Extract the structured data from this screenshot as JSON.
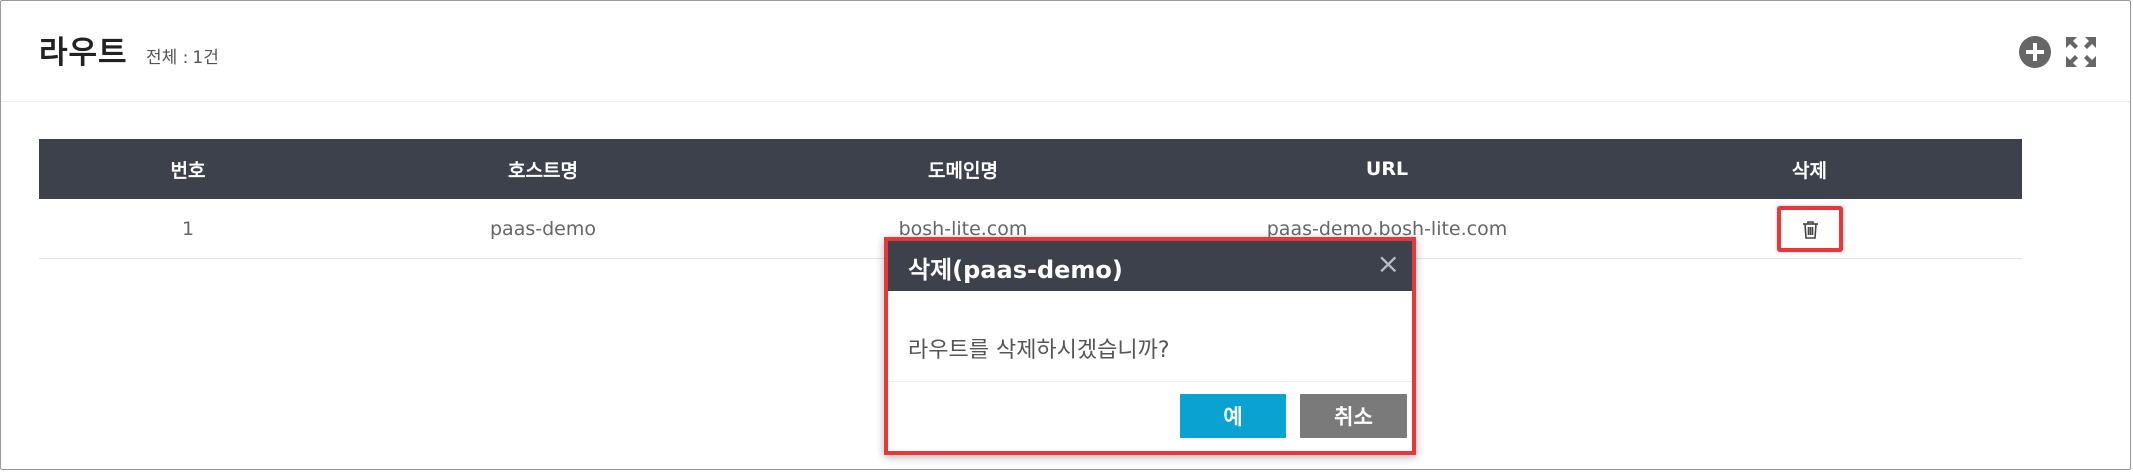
{
  "header": {
    "title": "라우트",
    "count_label": "전체 :",
    "count_value": "1건",
    "icons": [
      "add-circle-icon",
      "expand-icon"
    ]
  },
  "table": {
    "columns": [
      "번호",
      "호스트명",
      "도메인명",
      "URL",
      "삭제"
    ],
    "rows": [
      {
        "no": "1",
        "host": "paas-demo",
        "domain": "bosh-lite.com",
        "url": "paas-demo.bosh-lite.com",
        "delete_icon": "trash-icon"
      }
    ]
  },
  "dialog": {
    "title": "삭제(paas-demo)",
    "close_glyph": "×",
    "message": "라우트를 삭제하시겠습니까?",
    "confirm_label": "예",
    "cancel_label": "취소"
  },
  "colors": {
    "header_bg": "#3d414c",
    "highlight": "#e8363d",
    "confirm": "#0aa3d1",
    "cancel": "#7a7a7a"
  }
}
